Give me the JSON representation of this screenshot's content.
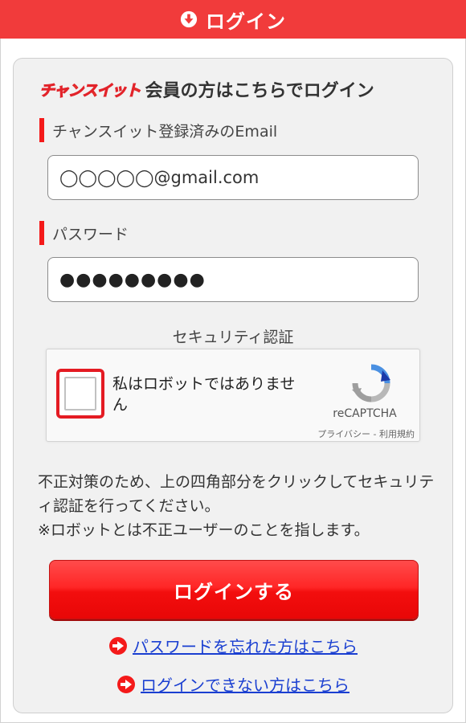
{
  "header": {
    "title": "ログイン"
  },
  "card": {
    "brand": "チャンスイット",
    "title": "会員の方はこちらでログイン"
  },
  "email": {
    "label": "チャンスイット登録済みのEmail",
    "value": "◯◯◯◯◯@gmail.com"
  },
  "password": {
    "label": "パスワード",
    "value": "●●●●●●●●●"
  },
  "security": {
    "label": "セキュリティ認証"
  },
  "recaptcha": {
    "checkbox_label": "私はロボットではありません",
    "brand": "reCAPTCHA",
    "links": "プライバシー - 利用規約"
  },
  "notice": {
    "line1": "不正対策のため、上の四角部分をクリックしてセキュリティ認証を行ってください。",
    "line2": "※ロボットとは不正ユーザーのことを指します。"
  },
  "login_button": {
    "label": "ログインする"
  },
  "links": {
    "forgot_password": "パスワードを忘れた方はこちら",
    "cannot_login": "ログインできない方はこちら"
  },
  "colors": {
    "header_bg": "#f13b3b",
    "accent_red": "#f41a1a",
    "button_red": "#ff2626",
    "link_blue": "#1a3fd1",
    "card_bg": "#f1f1f1"
  },
  "icons": {
    "header": "circle-arrow-down-icon",
    "forgot": "circle-arrow-right-icon",
    "cannot": "circle-arrow-right-icon",
    "recaptcha": "recaptcha-logo-icon"
  }
}
